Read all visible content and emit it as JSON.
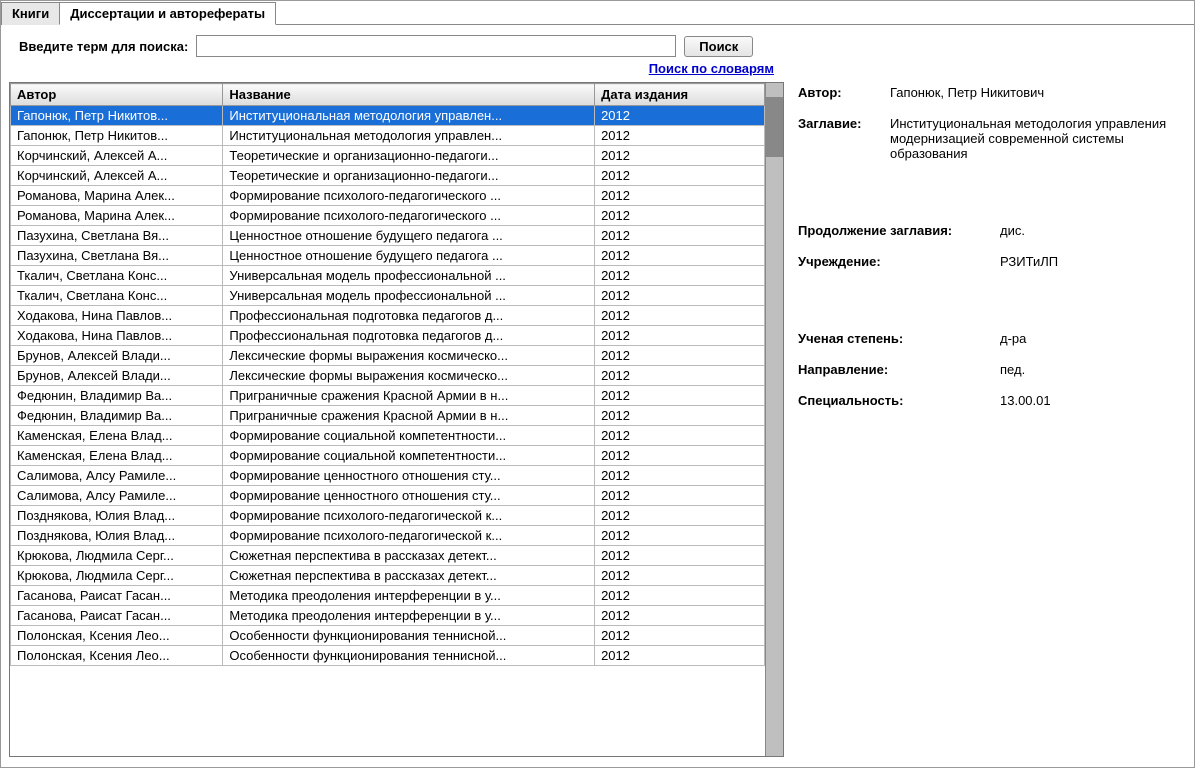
{
  "tabs": {
    "books": "Книги",
    "dissertations": "Диссертации и авторефераты"
  },
  "search": {
    "label": "Введите терм для поиска:",
    "button": "Поиск",
    "dict_link": "Поиск по словарям",
    "value": ""
  },
  "table": {
    "headers": {
      "author": "Автор",
      "title": "Название",
      "year": "Дата издания"
    },
    "selected_index": 0,
    "rows": [
      {
        "author": "Гапонюк, Петр Никитов...",
        "title": "Институциональная методология управлен...",
        "year": "2012"
      },
      {
        "author": "Гапонюк, Петр Никитов...",
        "title": "Институциональная методология управлен...",
        "year": "2012"
      },
      {
        "author": "Корчинский, Алексей А...",
        "title": "Теоретические и организационно-педагоги...",
        "year": "2012"
      },
      {
        "author": "Корчинский, Алексей А...",
        "title": "Теоретические и организационно-педагоги...",
        "year": "2012"
      },
      {
        "author": "Романова, Марина Алек...",
        "title": "Формирование психолого-педагогического ...",
        "year": "2012"
      },
      {
        "author": "Романова, Марина Алек...",
        "title": "Формирование психолого-педагогического ...",
        "year": "2012"
      },
      {
        "author": "Пазухина, Светлана Вя...",
        "title": "Ценностное отношение будущего педагога ...",
        "year": "2012"
      },
      {
        "author": "Пазухина, Светлана Вя...",
        "title": "Ценностное отношение будущего педагога ...",
        "year": "2012"
      },
      {
        "author": "Ткалич, Светлана Конс...",
        "title": "Универсальная модель профессиональной ...",
        "year": "2012"
      },
      {
        "author": "Ткалич, Светлана Конс...",
        "title": "Универсальная модель профессиональной ...",
        "year": "2012"
      },
      {
        "author": "Ходакова, Нина Павлов...",
        "title": "Профессиональная подготовка педагогов д...",
        "year": "2012"
      },
      {
        "author": "Ходакова, Нина Павлов...",
        "title": "Профессиональная подготовка педагогов д...",
        "year": "2012"
      },
      {
        "author": "Брунов, Алексей Влади...",
        "title": "Лексические формы выражения космическо...",
        "year": "2012"
      },
      {
        "author": "Брунов, Алексей Влади...",
        "title": "Лексические формы выражения космическо...",
        "year": "2012"
      },
      {
        "author": "Федюнин, Владимир Ва...",
        "title": "Приграничные сражения Красной Армии в н...",
        "year": "2012"
      },
      {
        "author": "Федюнин, Владимир Ва...",
        "title": "Приграничные сражения Красной Армии в н...",
        "year": "2012"
      },
      {
        "author": "Каменская, Елена Влад...",
        "title": "Формирование социальной компетентности...",
        "year": "2012"
      },
      {
        "author": "Каменская, Елена Влад...",
        "title": "Формирование социальной компетентности...",
        "year": "2012"
      },
      {
        "author": "Салимова, Алсу Рамиле...",
        "title": "Формирование ценностного отношения сту...",
        "year": "2012"
      },
      {
        "author": "Салимова, Алсу Рамиле...",
        "title": "Формирование ценностного отношения сту...",
        "year": "2012"
      },
      {
        "author": "Позднякова, Юлия Влад...",
        "title": "Формирование психолого-педагогической к...",
        "year": "2012"
      },
      {
        "author": "Позднякова, Юлия Влад...",
        "title": "Формирование психолого-педагогической к...",
        "year": "2012"
      },
      {
        "author": "Крюкова, Людмила Серг...",
        "title": "Сюжетная перспектива в рассказах детект...",
        "year": "2012"
      },
      {
        "author": "Крюкова, Людмила Серг...",
        "title": "Сюжетная перспектива в рассказах детект...",
        "year": "2012"
      },
      {
        "author": "Гасанова, Раисат Гасан...",
        "title": "Методика преодоления интерференции в у...",
        "year": "2012"
      },
      {
        "author": "Гасанова, Раисат Гасан...",
        "title": "Методика преодоления интерференции в у...",
        "year": "2012"
      },
      {
        "author": "Полонская, Ксения Лео...",
        "title": "Особенности функционирования теннисной...",
        "year": "2012"
      },
      {
        "author": "Полонская, Ксения Лео...",
        "title": "Особенности функционирования теннисной...",
        "year": "2012"
      }
    ]
  },
  "detail": {
    "author_label": "Автор:",
    "author_value": "Гапонюк, Петр Никитович",
    "title_label": "Заглавие:",
    "title_value": "Институциональная методология управления модернизацией современной системы образования",
    "subtitle_label": "Продолжение заглавия:",
    "subtitle_value": "дис.",
    "institution_label": "Учреждение:",
    "institution_value": "РЗИТиЛП",
    "degree_label": "Ученая степень:",
    "degree_value": "д-ра",
    "direction_label": "Направление:",
    "direction_value": "пед.",
    "specialty_label": "Специальность:",
    "specialty_value": "13.00.01"
  }
}
